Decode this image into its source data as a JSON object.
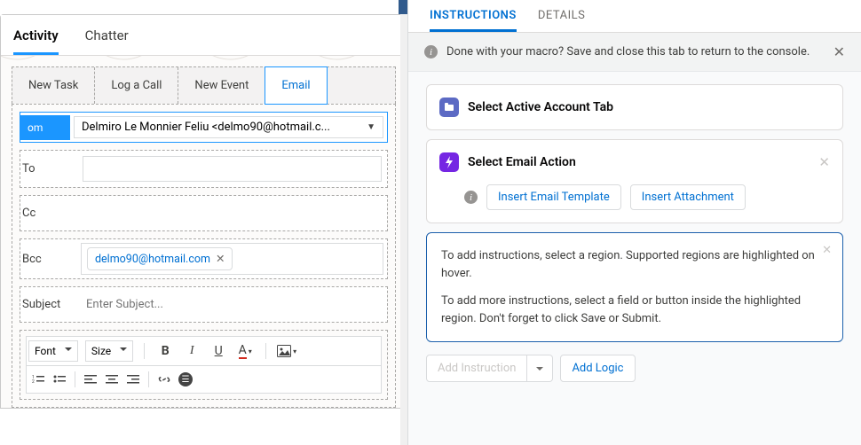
{
  "left": {
    "main_tabs": {
      "activity": "Activity",
      "chatter": "Chatter"
    },
    "subtabs": {
      "new_task": "New Task",
      "log_a_call": "Log a Call",
      "new_event": "New Event",
      "email": "Email"
    },
    "email": {
      "from_label": "om",
      "from_value": "Delmiro Le Monnier Feliu <delmo90@hotmail.c...",
      "to_label": "To",
      "cc_label": "Cc",
      "bcc_label": "Bcc",
      "bcc_pill": "delmo90@hotmail.com",
      "subject_label": "Subject",
      "subject_placeholder": "Enter Subject..."
    },
    "toolbar": {
      "font": "Font",
      "size": "Size"
    }
  },
  "right": {
    "tabs": {
      "instructions": "INSTRUCTIONS",
      "details": "DETAILS"
    },
    "banner": "Done with your macro? Save and close this tab to return to the console.",
    "step1": "Select Active Account Tab",
    "step2": "Select Email Action",
    "insert_tpl": "Insert Email Template",
    "insert_att": "Insert Attachment",
    "help1": "To add instructions, select a region. Supported regions are highlighted on hover.",
    "help2": "To add more instructions, select a field or button inside the highlighted region. Don't forget to click Save or Submit.",
    "add_instruction": "Add Instruction",
    "add_logic": "Add Logic"
  }
}
